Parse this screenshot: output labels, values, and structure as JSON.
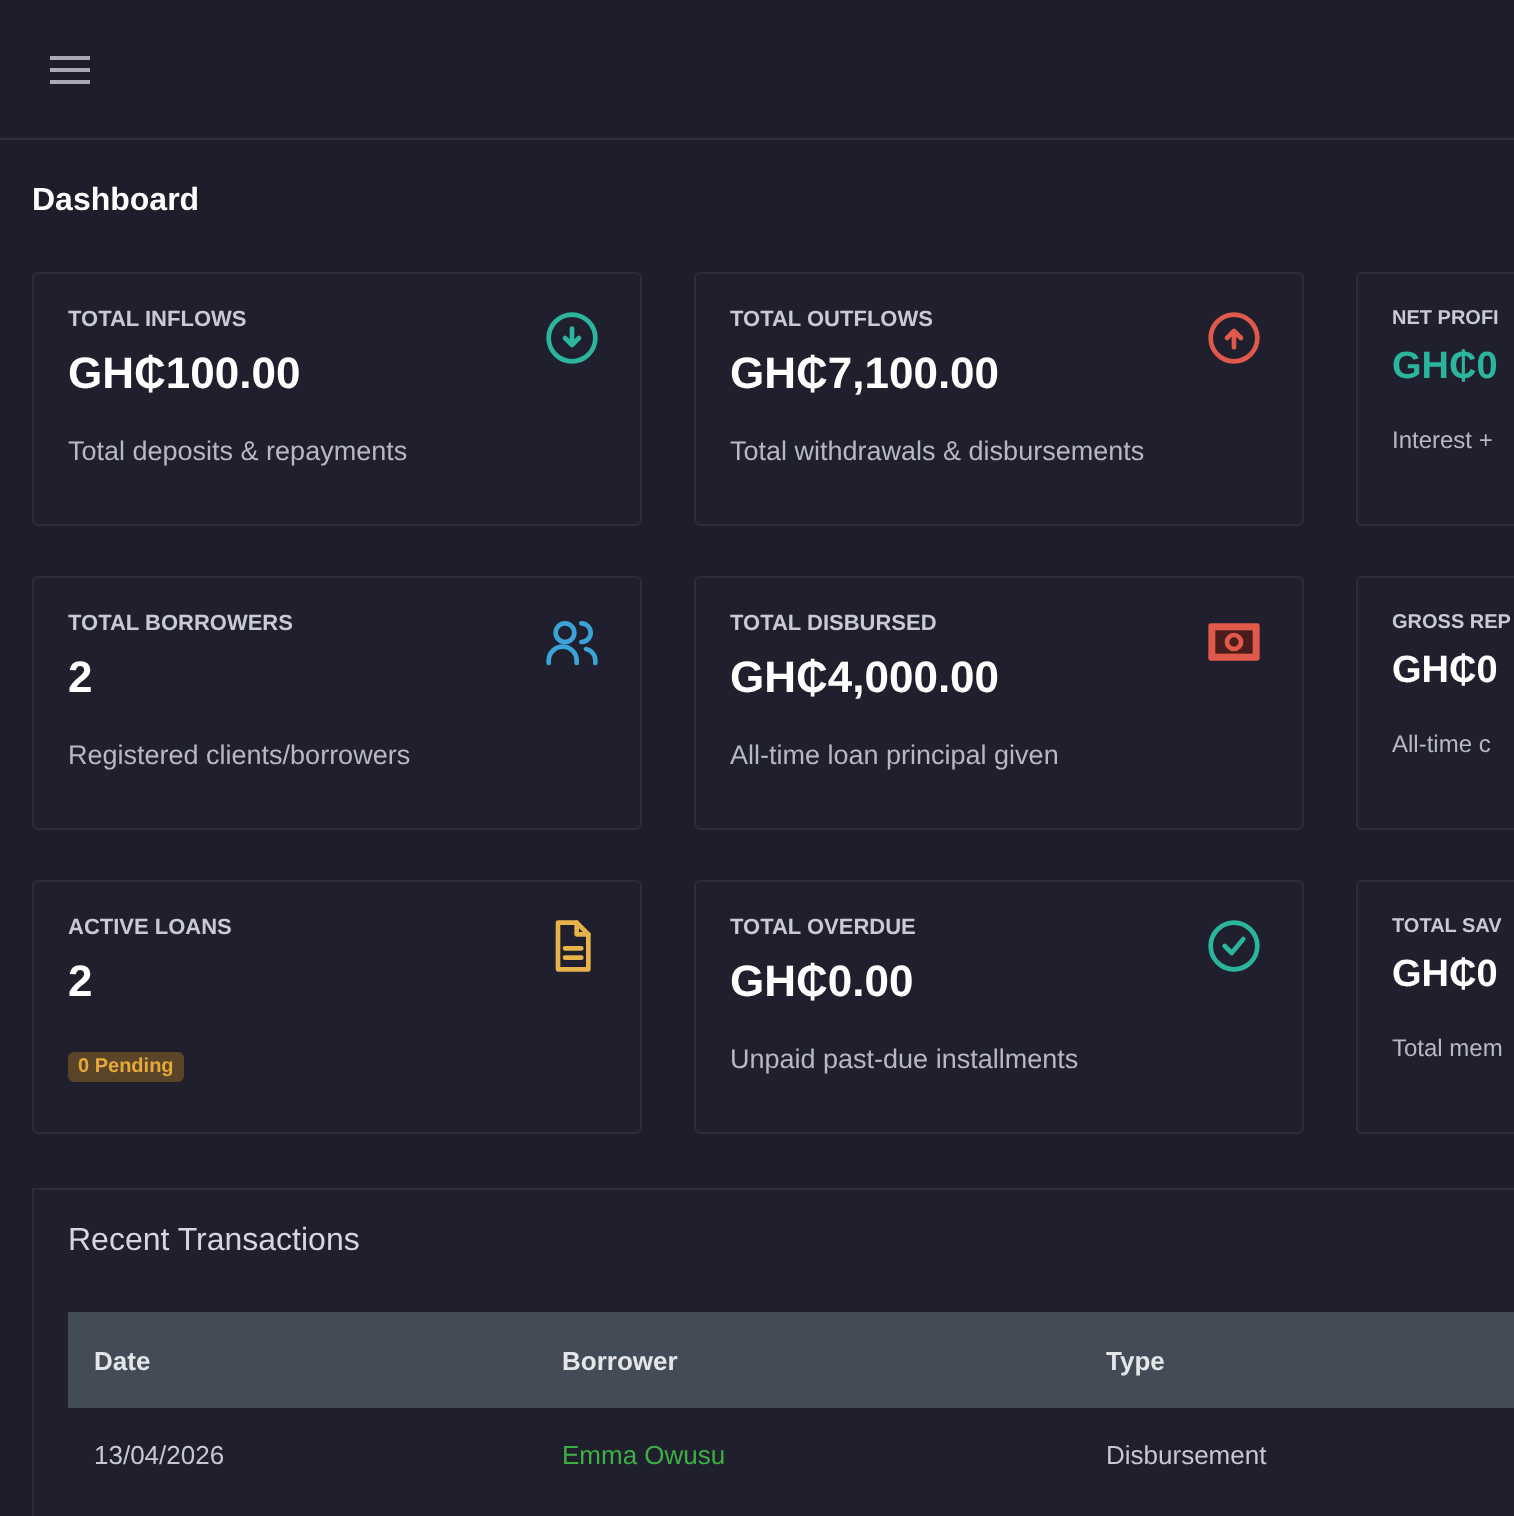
{
  "page_title": "Dashboard",
  "cards": [
    {
      "label": "TOTAL INFLOWS",
      "value": "GH₵100.00",
      "highlighted": false,
      "kind": "text",
      "caption": "Total deposits & repayments"
    },
    {
      "label": "TOTAL OUTFLOWS",
      "value": "GH₵7,100.00",
      "highlighted": false,
      "kind": "text",
      "caption": "Total withdrawals & disbursements"
    },
    {
      "label": "NET PROFI",
      "value": "GH₵0",
      "highlighted": true,
      "kind": "text",
      "caption": "Interest +"
    },
    {
      "label": "TOTAL BORROWERS",
      "value": "2",
      "highlighted": false,
      "kind": "text",
      "caption": "Registered clients/borrowers"
    },
    {
      "label": "TOTAL DISBURSED",
      "value": "GH₵4,000.00",
      "highlighted": false,
      "kind": "text",
      "caption": "All-time loan principal given"
    },
    {
      "label": "GROSS REP",
      "value": "GH₵0",
      "highlighted": false,
      "kind": "text",
      "caption": "All-time c"
    },
    {
      "label": "ACTIVE LOANS",
      "value": "2",
      "highlighted": false,
      "kind": "badge",
      "caption": "0 Pending"
    },
    {
      "label": "TOTAL OVERDUE",
      "value": "GH₵0.00",
      "highlighted": false,
      "kind": "text",
      "caption": "Unpaid past-due installments"
    },
    {
      "label": "TOTAL SAV",
      "value": "GH₵0",
      "highlighted": false,
      "kind": "text",
      "caption": "Total mem"
    }
  ],
  "transactions": {
    "title": "Recent Transactions",
    "columns": [
      "Date",
      "Borrower",
      "Type"
    ],
    "rows": [
      [
        "13/04/2026",
        "Emma Owusu",
        "Disbursement"
      ]
    ]
  }
}
